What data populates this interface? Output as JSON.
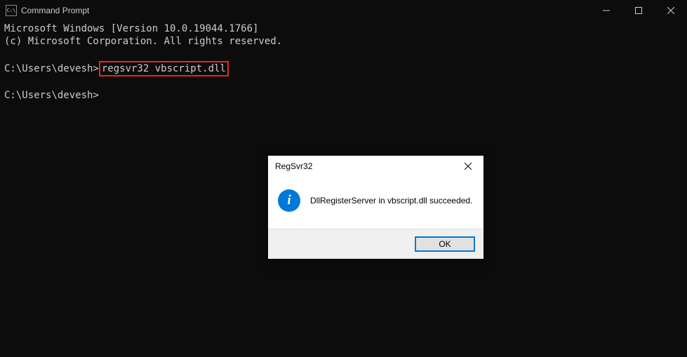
{
  "window": {
    "title": "Command Prompt",
    "icon_label": "C:\\"
  },
  "terminal": {
    "line1": "Microsoft Windows [Version 10.0.19044.1766]",
    "line2": "(c) Microsoft Corporation. All rights reserved.",
    "prompt1_prefix": "C:\\Users\\devesh>",
    "prompt1_command": "regsvr32 vbscript.dll",
    "prompt2": "C:\\Users\\devesh>"
  },
  "dialog": {
    "title": "RegSvr32",
    "message": "DllRegisterServer in vbscript.dll succeeded.",
    "ok_label": "OK"
  }
}
